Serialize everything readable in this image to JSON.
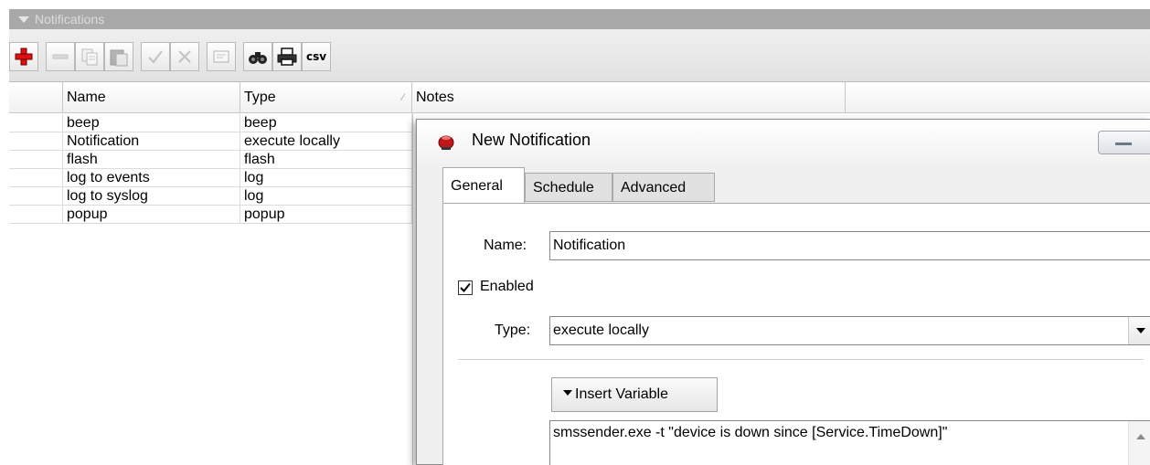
{
  "panel": {
    "title": "Notifications"
  },
  "toolbar": {
    "buttons": [
      {
        "icon": "add-icon"
      },
      {
        "icon": "remove-icon"
      },
      {
        "icon": "copy-icon"
      },
      {
        "icon": "paste-icon"
      },
      {
        "icon": "enable-icon"
      },
      {
        "icon": "disable-icon"
      },
      {
        "icon": "comment-icon"
      },
      {
        "icon": "find-icon"
      },
      {
        "icon": "print-icon"
      },
      {
        "icon": "csv-export-icon"
      }
    ],
    "csv_label": "csv"
  },
  "table": {
    "columns": [
      "Name",
      "Type",
      "Notes"
    ],
    "sort_indicator": "∕",
    "rows": [
      {
        "name": "beep",
        "type": "beep"
      },
      {
        "name": "Notification",
        "type": "execute locally"
      },
      {
        "name": "flash",
        "type": "flash"
      },
      {
        "name": "log to events",
        "type": "log"
      },
      {
        "name": "log to syslog",
        "type": "log"
      },
      {
        "name": "popup",
        "type": "popup"
      }
    ]
  },
  "dialog": {
    "title": "New Notification",
    "tabs": [
      "General",
      "Schedule",
      "Advanced"
    ],
    "active_tab": "General",
    "name_label": "Name:",
    "name_value": "Notification",
    "enabled_label": "Enabled",
    "enabled_checked": true,
    "type_label": "Type:",
    "type_value": "execute locally",
    "insert_variable_label": "Insert Variable",
    "command_value": "smssender.exe -t \"device is down since [Service.TimeDown]\""
  }
}
